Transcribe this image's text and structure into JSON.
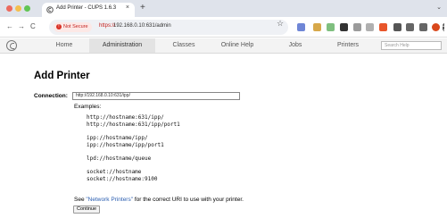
{
  "browser": {
    "tab_title": "Add Printer - CUPS 1.6.3",
    "tab_close": "×",
    "new_tab": "+",
    "tab_menu": "⌄",
    "security_label": "Not Secure",
    "url_scheme": "https://",
    "url_rest": "192.168.0.10:631/admin",
    "nav_icons": [
      "back-icon",
      "forward-icon",
      "reload-icon"
    ],
    "back": "←",
    "forward": "→",
    "reload": "C",
    "bookmark_star": "☆",
    "extension_icons": [
      {
        "name": "extension-a-icon",
        "color": "#6f86d6"
      },
      {
        "name": "extension-b-icon",
        "color": "#d7a84a"
      },
      {
        "name": "extension-c-icon",
        "color": "#7fbf7f"
      },
      {
        "name": "extension-d-icon",
        "color": "#333333"
      },
      {
        "name": "extension-e-icon",
        "color": "#9b9b9b"
      },
      {
        "name": "extension-f-icon",
        "color": "#b0b0b0"
      },
      {
        "name": "extension-g-icon",
        "color": "#e8552a"
      },
      {
        "name": "extension-h-icon",
        "color": "#555555"
      },
      {
        "name": "reading-list-icon",
        "color": "#666666"
      },
      {
        "name": "side-panel-icon",
        "color": "#666666"
      },
      {
        "name": "profile-avatar-icon",
        "color": "#d9481c"
      },
      {
        "name": "kebab-menu-icon",
        "color": "#555555"
      }
    ]
  },
  "cups_nav": {
    "items": [
      "Home",
      "Administration",
      "Classes",
      "Online Help",
      "Jobs",
      "Printers"
    ],
    "active": "Administration",
    "search_placeholder": "Search Help"
  },
  "page": {
    "title": "Add Printer",
    "connection_label": "Connection:",
    "connection_value": "http://192.168.0.10:631/ipp/",
    "examples_label": "Examples:",
    "example_groups": [
      [
        "http://hostname:631/ipp/",
        "http://hostname:631/ipp/port1"
      ],
      [
        "ipp://hostname/ipp/",
        "ipp://hostname/ipp/port1"
      ],
      [
        "lpd://hostname/queue"
      ],
      [
        "socket://hostname",
        "socket://hostname:9100"
      ]
    ],
    "see_prefix": "See ",
    "see_link": "\"Network Printers\"",
    "see_suffix": " for the correct URI to use with your printer.",
    "continue_label": "Continue"
  }
}
